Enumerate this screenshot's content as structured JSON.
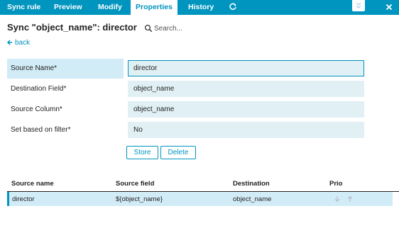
{
  "tabs": [
    {
      "label": "Sync rule"
    },
    {
      "label": "Preview"
    },
    {
      "label": "Modify"
    },
    {
      "label": "Properties"
    },
    {
      "label": "History"
    }
  ],
  "header": {
    "title": "Sync \"object_name\": director",
    "search_placeholder": "Search..."
  },
  "back": {
    "label": "back"
  },
  "form": {
    "source_name": {
      "label": "Source Name*",
      "value": "director"
    },
    "destination_field": {
      "label": "Destination Field*",
      "value": "object_name"
    },
    "source_column": {
      "label": "Source Column*",
      "value": "object_name"
    },
    "set_based_on_filter": {
      "label": "Set based on filter*",
      "value": "No"
    },
    "store_label": "Store",
    "delete_label": "Delete"
  },
  "table": {
    "columns": [
      "Source name",
      "Source field",
      "Destination",
      "Prio"
    ],
    "rows": [
      {
        "source_name": "director",
        "source_field": "${object_name}",
        "destination": "object_name"
      }
    ]
  },
  "colors": {
    "accent": "#0095bf",
    "highlight": "#d2ecf7",
    "field_bg": "#e0f0f5"
  },
  "icons": [
    "refresh-icon",
    "minimize-icon",
    "close-icon",
    "search-icon",
    "back-arrow-icon",
    "arrow-down-icon",
    "arrow-up-icon"
  ]
}
